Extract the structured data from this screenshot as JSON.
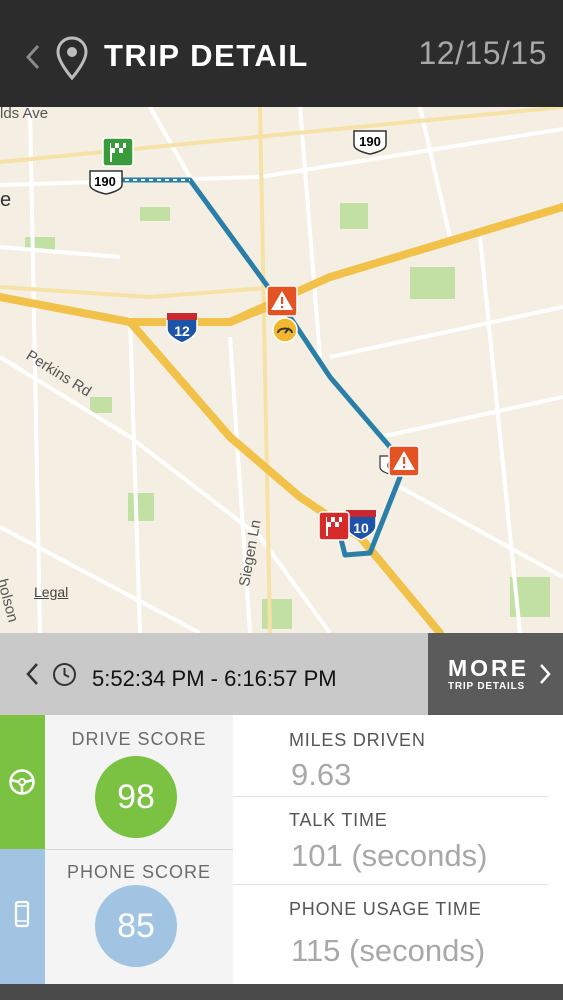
{
  "header": {
    "title": "TRIP DETAIL",
    "date": "12/15/15",
    "back_icon": "chevron-left-icon",
    "location_icon": "map-pin-icon"
  },
  "map": {
    "labels": {
      "ave": "lds Ave",
      "e": "e",
      "perkins": "Perkins Rd",
      "siegen": "Siegen Ln",
      "nicholson": "holson",
      "legal": "Legal"
    },
    "shields": {
      "i12": "12",
      "i10": "10",
      "us190_top": "190",
      "us190_left": "190",
      "partial": "6"
    },
    "markers": [
      "start-flag-icon",
      "warning-icon",
      "speed-icon",
      "warning-icon",
      "end-flag-icon"
    ],
    "colors": {
      "route": "#2a7fa8",
      "freeway": "#f2c14a",
      "land": "#f4efe2",
      "park": "#c3e0a4"
    }
  },
  "trip": {
    "time_range": "5:52:34 PM - 6:16:57 PM",
    "more_label": "MORE",
    "more_sub": "TRIP DETAILS"
  },
  "scores": {
    "drive": {
      "label": "DRIVE SCORE",
      "value": "98",
      "color": "#7cc242",
      "icon": "steering-wheel-icon"
    },
    "phone": {
      "label": "PHONE SCORE",
      "value": "85",
      "color": "#a0c4e2",
      "icon": "phone-icon"
    }
  },
  "stats": {
    "miles": {
      "label": "MILES DRIVEN",
      "value": "9.63"
    },
    "talk": {
      "label": "TALK TIME",
      "value": "101 (seconds)"
    },
    "usage": {
      "label": "PHONE USAGE TIME",
      "value": "115 (seconds)"
    }
  }
}
